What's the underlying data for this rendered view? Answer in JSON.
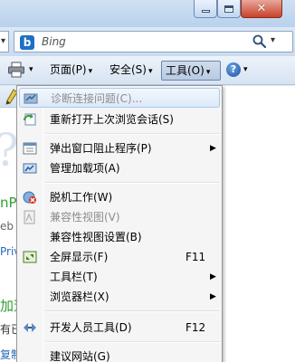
{
  "search": {
    "placeholder": "Bing",
    "engine_icon": "bing-icon"
  },
  "window_controls": {
    "minimize_icon": "minimize-icon",
    "maximize_icon": "maximize-icon",
    "close_icon": "close-icon",
    "close_color": "#c9412b"
  },
  "command_bar": {
    "print_icon": "printer-icon",
    "page_label": "页面(P)",
    "safety_label": "安全(S)",
    "tools_label": "工具(O)",
    "help_icon": "help-icon"
  },
  "background_page": {
    "t1": "nP",
    "t2": "eb ·",
    "t3": "Priv",
    "t4": "加速",
    "t5": "有已",
    "t6": "复制"
  },
  "tools_menu": {
    "items": [
      {
        "label": "诊断连接问题(C)...",
        "disabled": true,
        "icon": "diagnose-icon"
      },
      {
        "label": "重新打开上次浏览会话(S)",
        "icon": "reopen-session-icon"
      },
      {
        "label": "弹出窗口阻止程序(P)",
        "submenu": true,
        "icon": "popup-blocker-icon"
      },
      {
        "label": "管理加载项(A)",
        "icon": "addons-icon"
      },
      {
        "label": "脱机工作(W)",
        "icon": "offline-icon"
      },
      {
        "label": "兼容性视图(V)",
        "disabled": true,
        "icon": "compat-view-icon"
      },
      {
        "label": "兼容性视图设置(B)"
      },
      {
        "label": "全屏显示(F)",
        "shortcut": "F11",
        "icon": "fullscreen-icon"
      },
      {
        "label": "工具栏(T)",
        "submenu": true
      },
      {
        "label": "浏览器栏(X)",
        "submenu": true
      },
      {
        "label": "开发人员工具(D)",
        "shortcut": "F12",
        "icon": "developer-tools-icon"
      },
      {
        "label": "建议网站(G)"
      }
    ]
  },
  "colors": {
    "menu_background": "#f5f5f5",
    "hover_border": "#a8c8ec",
    "disabled_text": "#8d8d8d"
  }
}
